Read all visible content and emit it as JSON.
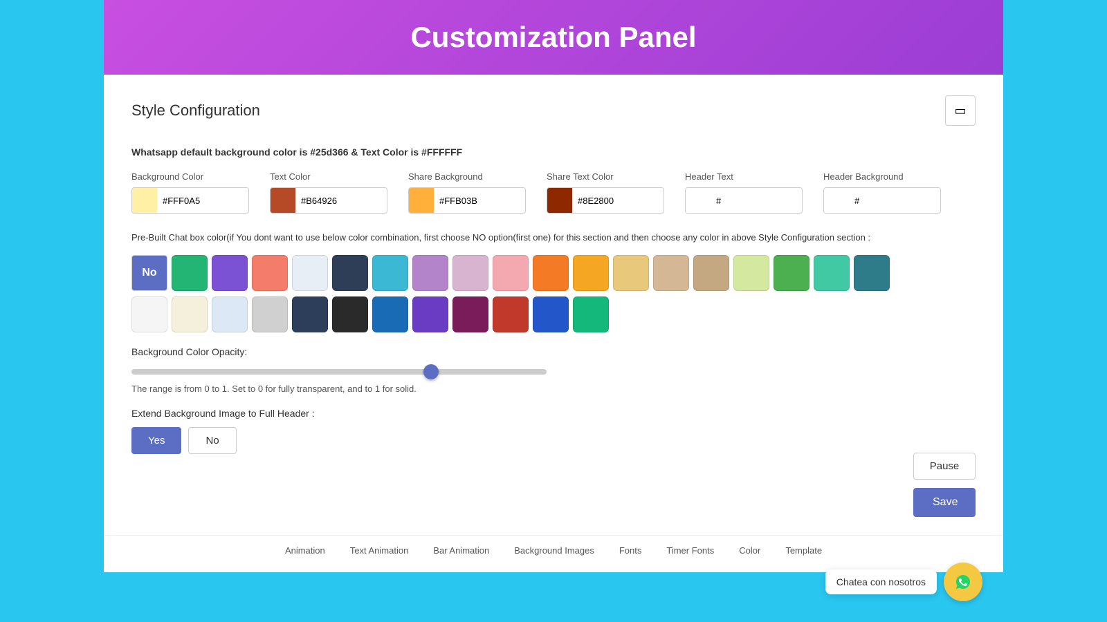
{
  "header": {
    "title": "Customization Panel",
    "bg_color": "#c84fe0"
  },
  "style_config": {
    "title": "Style Configuration",
    "whatsapp_info": "Whatsapp default background color is #25d366 & Text Color is #FFFFFF",
    "fields": [
      {
        "label": "Background Color",
        "swatch": "#FFF0A5",
        "value": "#FFF0A5"
      },
      {
        "label": "Text Color",
        "swatch": "#B64926",
        "value": "#B64926"
      },
      {
        "label": "Share Background",
        "swatch": "#FFB03B",
        "value": "#FFB03B"
      },
      {
        "label": "Share Text Color",
        "swatch": "#8E2800",
        "value": "#8E2800"
      },
      {
        "label": "Header Text",
        "swatch": "#FFFFFF",
        "value": "#"
      },
      {
        "label": "Header Background",
        "swatch": "#FFFFFF",
        "value": "#"
      }
    ],
    "prebuilt_info": "Pre-Built Chat box color(if You dont want to use below color combination, first choose NO option(first one) for this section and then choose any color in above Style Configuration section :",
    "palette_row1": [
      {
        "color": "no",
        "label": "No"
      },
      {
        "color": "#22b573"
      },
      {
        "color": "#7b52d3"
      },
      {
        "color": "#f47c6a"
      },
      {
        "color": "#e8eef5"
      },
      {
        "color": "#2e3e57"
      },
      {
        "color": "#3bb8d4"
      },
      {
        "color": "#b384c9"
      },
      {
        "color": "#d8b4d0"
      },
      {
        "color": "#f4a8b0"
      },
      {
        "color": "#f47a25"
      },
      {
        "color": "#f5a623"
      },
      {
        "color": "#e8c87a"
      },
      {
        "color": "#d4b896"
      },
      {
        "color": "#c4a882"
      },
      {
        "color": "#d4e8a0"
      },
      {
        "color": "#4caf50"
      },
      {
        "color": "#40c9a2"
      },
      {
        "color": "#2e7c8a"
      }
    ],
    "palette_row2": [
      {
        "color": "#f5f5f5"
      },
      {
        "color": "#f5f0dc"
      },
      {
        "color": "#dce8f5"
      },
      {
        "color": "#d0d0d0"
      },
      {
        "color": "#2c3e5a"
      },
      {
        "color": "#2a2a2a"
      },
      {
        "color": "#1a6bb5"
      },
      {
        "color": "#6a3cc4"
      },
      {
        "color": "#7a1c5a"
      },
      {
        "color": "#c0392b"
      },
      {
        "color": "#2356c9"
      },
      {
        "color": "#14b87a"
      }
    ],
    "opacity": {
      "label": "Background Color Opacity:",
      "value": 0.73,
      "hint": "The range is from 0 to 1. Set to 0 for fully transparent, and to 1 for solid."
    },
    "extend_bg": {
      "label": "Extend Background Image to Full Header :",
      "yes_active": true
    },
    "buttons": {
      "pause": "Pause",
      "save": "Save"
    },
    "device_icon": "▭"
  },
  "bottom_nav": [
    "Animation",
    "Text Animation",
    "Bar Animation",
    "Background Images",
    "Fonts",
    "Timer Fonts",
    "Color",
    "Template"
  ],
  "chat_widget": {
    "bubble_text": "Chatea con nosotros",
    "icon": "💬"
  }
}
